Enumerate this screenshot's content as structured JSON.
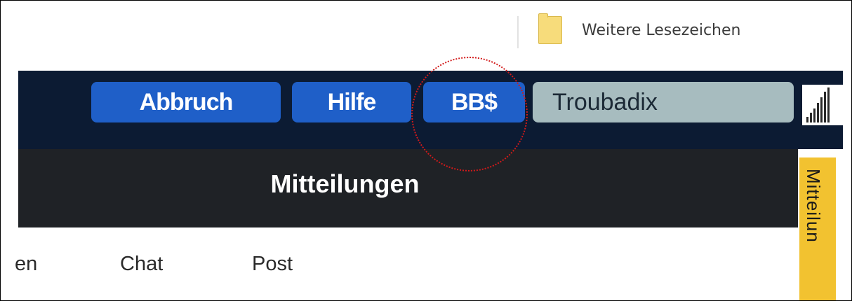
{
  "bookmarks": {
    "folder_label": "Weitere Lesezeichen",
    "folder_icon": "folder-icon"
  },
  "header": {
    "buttons": [
      {
        "label": "Abbruch"
      },
      {
        "label": "Hilfe"
      },
      {
        "label": "BB$"
      }
    ],
    "username": "Troubadix",
    "signal_icon": "signal-bars-icon",
    "accent_color": "#1f5fc8",
    "background_color": "#0c1b33"
  },
  "title_bar": {
    "title": "Mitteilungen"
  },
  "side_tab": {
    "label": "Mitteilun",
    "color": "#f2c230"
  },
  "nav": {
    "items": [
      {
        "label": "en"
      },
      {
        "label": "Chat"
      },
      {
        "label": "Post"
      }
    ]
  },
  "annotation": {
    "color": "#d21a1a",
    "target": "BB$"
  }
}
